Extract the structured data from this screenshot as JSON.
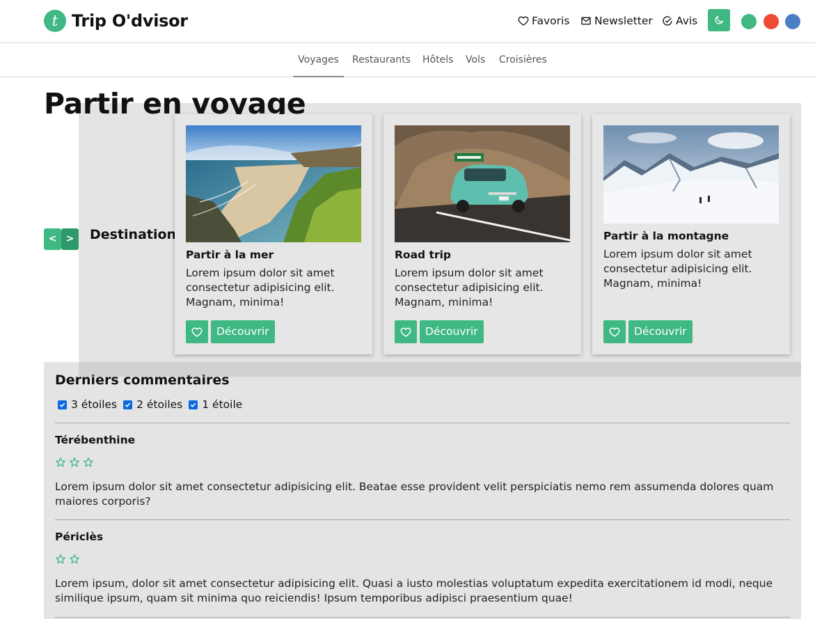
{
  "header": {
    "logo_letter": "t",
    "logo_text": "Trip O'dvisor",
    "links": {
      "favoris": {
        "label": "Favoris",
        "icon": "heart-icon"
      },
      "newsletter": {
        "label": "Newsletter",
        "icon": "envelope-icon"
      },
      "avis": {
        "label": "Avis",
        "icon": "check-circle-icon"
      }
    },
    "theme_toggle_icon": "moon-icon",
    "color_dots": [
      "#3fb883",
      "#ee4b34",
      "#4a7fc4"
    ]
  },
  "tabs": [
    "Voyages",
    "Restaurants",
    "Hôtels",
    "Vols",
    "Croisières"
  ],
  "active_tab": "Voyages",
  "page_title": "Partir en voyage",
  "carousel": {
    "prev_label": "<",
    "next_label": ">",
    "section_label": "Destinations"
  },
  "cards": [
    {
      "title": "Partir à la mer",
      "text": "Lorem ipsum dolor sit amet consectetur adipisicing elit. Magnam, minima!",
      "button": "Découvrir",
      "image": "sea-cliff-beach"
    },
    {
      "title": "Road trip",
      "text": "Lorem ipsum dolor sit amet consectetur adipisicing elit. Magnam, minima!",
      "button": "Découvrir",
      "image": "vintage-car-road"
    },
    {
      "title": "Partir à la montagne",
      "text": "Lorem ipsum dolor sit amet consectetur adipisicing elit. Magnam, minima!",
      "button": "Découvrir",
      "image": "snowy-mountains-skiers"
    }
  ],
  "comments_section": {
    "title": "Derniers commentaires",
    "filters": [
      {
        "label": "3 étoiles",
        "checked": true
      },
      {
        "label": "2 étoiles",
        "checked": true
      },
      {
        "label": "1 étoile",
        "checked": true
      }
    ],
    "comments": [
      {
        "author": "Térébenthine",
        "stars": 3,
        "text": "Lorem ipsum dolor sit amet consectetur adipisicing elit. Beatae esse provident velit perspiciatis nemo rem assumenda dolores quam maiores corporis?"
      },
      {
        "author": "Périclès",
        "stars": 2,
        "text": "Lorem ipsum, dolor sit amet consectetur adipisicing elit. Quasi a iusto molestias voluptatum expedita exercitationem id modi, neque similique ipsum, quam sit minima quo reiciendis! Ipsum temporibus adipisci praesentium quae!"
      }
    ]
  },
  "colors": {
    "accent": "#3fb883",
    "accent_dark": "#2e9a6a",
    "panel": "#e4e4e4"
  }
}
